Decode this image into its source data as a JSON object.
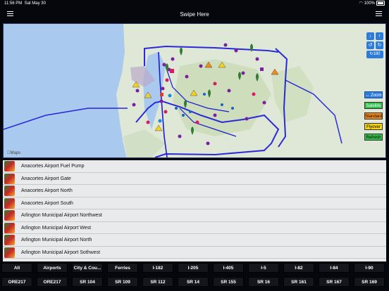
{
  "status": {
    "time": "11:56 PM",
    "date": "Sat May 30",
    "battery": "100%"
  },
  "header": {
    "title": "Swipe Here"
  },
  "map": {
    "attribution": "Maps",
    "zoom_label": "Zoom",
    "rotate_label": "180",
    "layers": [
      {
        "label": "Satellite",
        "color": "#2fbf4a"
      },
      {
        "label": "Standard",
        "color": "#f08a1c"
      },
      {
        "label": "Flyover",
        "color": "#f4d21a"
      },
      {
        "label": "Refresh",
        "color": "#2fbf4a"
      }
    ]
  },
  "list": [
    "Anacortes Airport Fuel Pump",
    "Anacortes Airport Gate",
    "Anacortes Airport North",
    "Anacortes Airport South",
    "Arlington Municipal Airport Northwest",
    "Arlington Municipal Airport West",
    "Arlington Municipal Airport North",
    "Arlington Municipal Airport Sothwest"
  ],
  "filters_row1": [
    "All",
    "Airports",
    "City & Cou...",
    "Ferries",
    "I-182",
    "I-205",
    "I-405",
    "I-5",
    "I-82",
    "I-84",
    "I-90"
  ],
  "filters_row2": [
    "ORE217",
    "ORE217",
    "SR 104",
    "SR 109",
    "SR 112",
    "SR 14",
    "SR 155",
    "SR 16",
    "SR 161",
    "SR 167",
    "SR 169"
  ]
}
